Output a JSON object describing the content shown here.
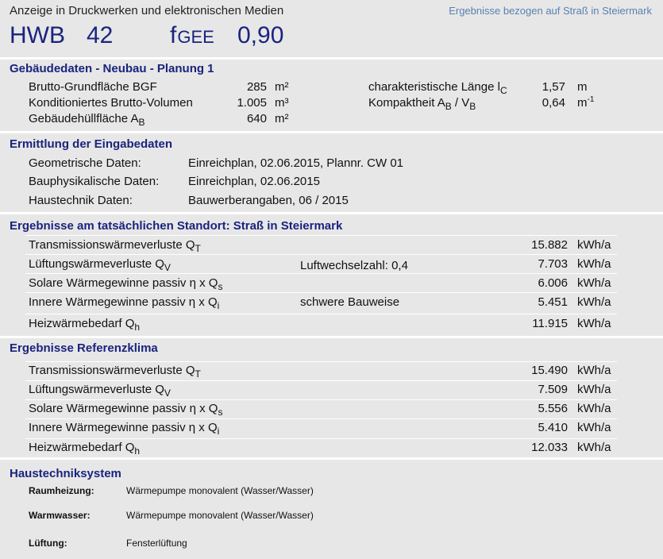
{
  "header": {
    "ad_text": "Anzeige in Druckwerken und elektronischen Medien",
    "ref_text": "Ergebnisse bezogen auf Straß in Steiermark",
    "hwb_label": "HWB",
    "hwb_value": "42",
    "fgee_label": "f",
    "fgee_sub": "GEE",
    "fgee_value": "0,90"
  },
  "building": {
    "title": "Gebäudedaten - Neubau - Planung 1",
    "bgf_label": "Brutto-Grundfläche BGF",
    "bgf_value": "285",
    "bgf_unit": "m²",
    "vol_label": "Konditioniertes Brutto-Volumen",
    "vol_value": "1.005",
    "vol_unit": "m³",
    "hull_label": "Gebäudehüllfläche A",
    "hull_sub": "B",
    "hull_value": "640",
    "hull_unit": "m²",
    "lc_label": "charakteristische Länge l",
    "lc_sub": "C",
    "lc_value": "1,57",
    "lc_unit": "m",
    "comp_label": "Kompaktheit A",
    "comp_sub1": "B",
    "comp_mid": " / V",
    "comp_sub2": "B",
    "comp_value": "0,64",
    "comp_unit": "m",
    "comp_unit_sup": "-1"
  },
  "input_data": {
    "title": "Ermittlung der Eingabedaten",
    "rows": [
      {
        "label": "Geometrische Daten:",
        "value": "Einreichplan, 02.06.2015, Plannr. CW 01"
      },
      {
        "label": "Bauphysikalische Daten:",
        "value": "Einreichplan, 02.06.2015"
      },
      {
        "label": "Haustechnik Daten:",
        "value": "Bauwerberangaben, 06 / 2015"
      }
    ]
  },
  "site_results": {
    "title": "Ergebnisse am tatsächlichen Standort: Straß in Steiermark",
    "rows": [
      {
        "label": "Transmissionswärmeverluste Q",
        "sub": "T",
        "note": "",
        "value": "15.882",
        "unit": "kWh/a"
      },
      {
        "label": "Lüftungswärmeverluste Q",
        "sub": "V",
        "note": "Luftwechselzahl: 0,4",
        "value": "7.703",
        "unit": "kWh/a"
      },
      {
        "label": "Solare Wärmegewinne passiv  η x Q",
        "sub": "s",
        "note": "",
        "value": "6.006",
        "unit": "kWh/a"
      },
      {
        "label": "Innere Wärmegewinne passiv  η x Q",
        "sub": "i",
        "note": "schwere Bauweise",
        "value": "5.451",
        "unit": "kWh/a"
      },
      {
        "label": "Heizwärmebedarf Q",
        "sub": "h",
        "note": "",
        "value": "11.915",
        "unit": "kWh/a"
      }
    ]
  },
  "ref_results": {
    "title": "Ergebnisse Referenzklima",
    "rows": [
      {
        "label": "Transmissionswärmeverluste Q",
        "sub": "T",
        "value": "15.490",
        "unit": "kWh/a"
      },
      {
        "label": "Lüftungswärmeverluste Q",
        "sub": "V",
        "value": "7.509",
        "unit": "kWh/a"
      },
      {
        "label": "Solare Wärmegewinne passiv  η x Q",
        "sub": "s",
        "value": "5.556",
        "unit": "kWh/a"
      },
      {
        "label": "Innere Wärmegewinne passiv  η x Q",
        "sub": "i",
        "value": "5.410",
        "unit": "kWh/a"
      },
      {
        "label": "Heizwärmebedarf Q",
        "sub": "h",
        "value": "12.033",
        "unit": "kWh/a"
      }
    ]
  },
  "systems": {
    "title": "Haustechniksystem",
    "rows": [
      {
        "label": "Raumheizung:",
        "value": "Wärmepumpe monovalent (Wasser/Wasser)"
      },
      {
        "label": "Warmwasser:",
        "value": "Wärmepumpe monovalent (Wasser/Wasser)"
      },
      {
        "label": "Lüftung:",
        "value": "Fensterlüftung"
      }
    ]
  }
}
